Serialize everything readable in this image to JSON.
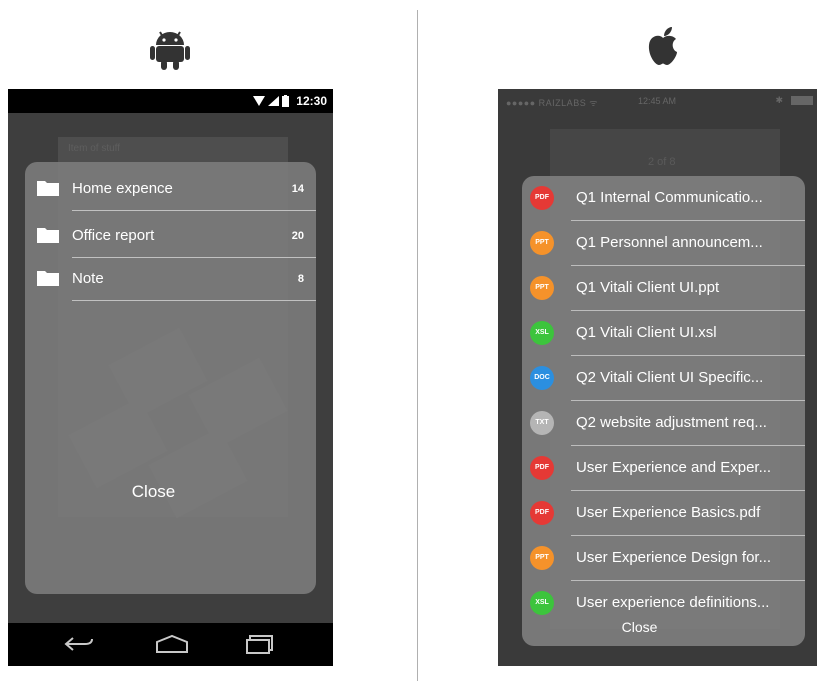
{
  "android": {
    "status_time": "12:30",
    "background_header": "Item of stuff",
    "folders": [
      {
        "label": "Home expence",
        "count": "14"
      },
      {
        "label": "Office report",
        "count": "20"
      },
      {
        "label": "Note",
        "count": "8"
      }
    ],
    "close_label": "Close",
    "icons": {
      "platform": "android-icon",
      "back": "back-icon",
      "home": "home-icon",
      "recents": "recents-icon",
      "folder": "folder-icon"
    }
  },
  "ios": {
    "status_carrier": "●●●●● RAIZLABS ᯤ",
    "status_time": "12:45 AM",
    "status_bluetooth": "✱",
    "background_text": "2 of 8",
    "files": [
      {
        "badge": "PDF",
        "name": "Q1 Internal Communicatio...",
        "color": "#e53935"
      },
      {
        "badge": "PPT",
        "name": "Q1 Personnel announcem...",
        "color": "#f5922a"
      },
      {
        "badge": "PPT",
        "name": "Q1 Vitali Client UI.ppt",
        "color": "#f5922a"
      },
      {
        "badge": "XSL",
        "name": "Q1 Vitali Client UI.xsl",
        "color": "#3cc43c"
      },
      {
        "badge": "DOC",
        "name": "Q2 Vitali Client UI Specific...",
        "color": "#2b8fe0"
      },
      {
        "badge": "TXT",
        "name": "Q2 website adjustment req...",
        "color": "#b5b5b5"
      },
      {
        "badge": "PDF",
        "name": "User Experience and Exper...",
        "color": "#e53935"
      },
      {
        "badge": "PDF",
        "name": "User Experience Basics.pdf",
        "color": "#e53935"
      },
      {
        "badge": "PPT",
        "name": "User Experience Design for...",
        "color": "#f5922a"
      },
      {
        "badge": "XSL",
        "name": "User experience definitions...",
        "color": "#3cc43c"
      }
    ],
    "close_label": "Close",
    "icons": {
      "platform": "apple-icon"
    }
  }
}
